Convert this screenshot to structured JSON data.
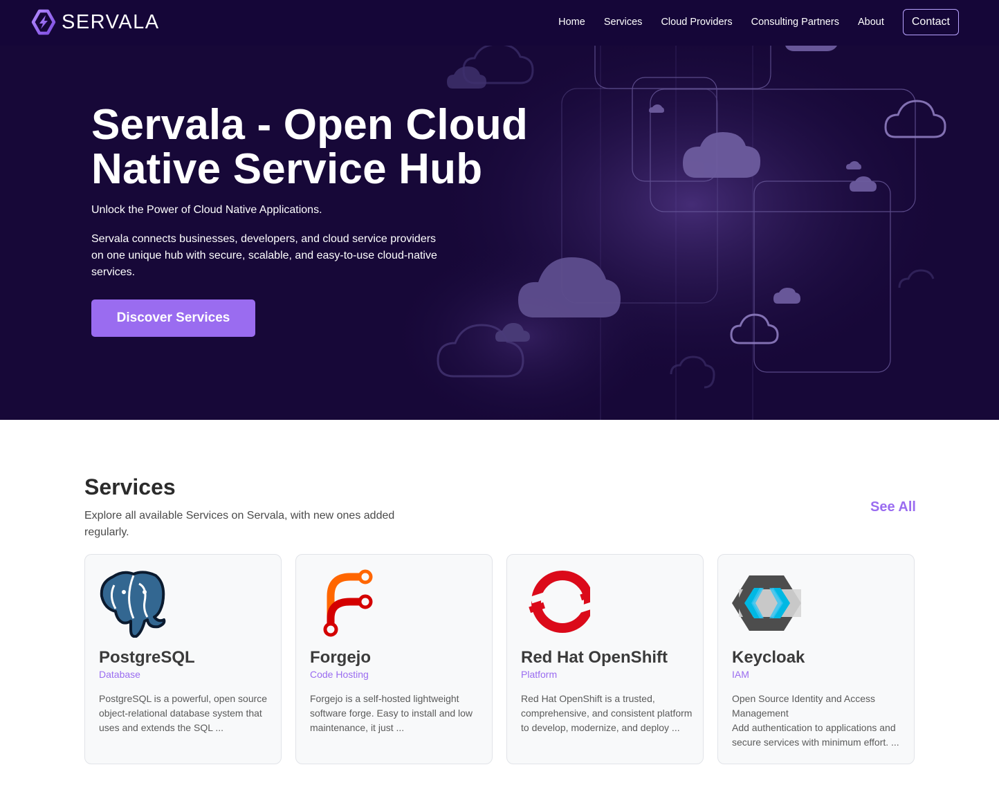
{
  "header": {
    "brand": "SERVALA",
    "nav": [
      {
        "label": "Home"
      },
      {
        "label": "Services"
      },
      {
        "label": "Cloud Providers"
      },
      {
        "label": "Consulting Partners"
      },
      {
        "label": "About"
      }
    ],
    "contact_label": "Contact"
  },
  "hero": {
    "title": "Servala - Open Cloud Native Service Hub",
    "subtitle": "Unlock the Power of Cloud Native Applications.",
    "description": "Servala connects businesses, developers, and cloud service providers on one unique hub with secure, scalable, and easy-to-use cloud-native services.",
    "cta_label": "Discover Services"
  },
  "services": {
    "title": "Services",
    "description": "Explore all available Services on Servala, with new ones added regularly.",
    "see_all_label": "See All",
    "cards": [
      {
        "name": "PostgreSQL",
        "category": "Database",
        "description": "PostgreSQL is a powerful, open source object-relational database system that uses and extends the SQL ...",
        "icon": "postgresql-elephant-icon"
      },
      {
        "name": "Forgejo",
        "category": "Code Hosting",
        "description": "Forgejo is a self-hosted lightweight software forge. Easy to install and low maintenance, it just ...",
        "icon": "forgejo-icon"
      },
      {
        "name": "Red Hat OpenShift",
        "category": "Platform",
        "description": "Red Hat OpenShift is a trusted, comprehensive, and consistent platform to develop, modernize, and deploy ...",
        "icon": "openshift-icon"
      },
      {
        "name": "Keycloak",
        "category": "IAM",
        "description": "Open Source Identity and Access Management\nAdd authentication to applications and secure services with minimum effort. ...",
        "icon": "keycloak-icon"
      }
    ]
  },
  "colors": {
    "header_bg": "#150638",
    "hero_bg": "#170838",
    "accent": "#9a6cf0",
    "card_bg": "#f8f9fa"
  }
}
